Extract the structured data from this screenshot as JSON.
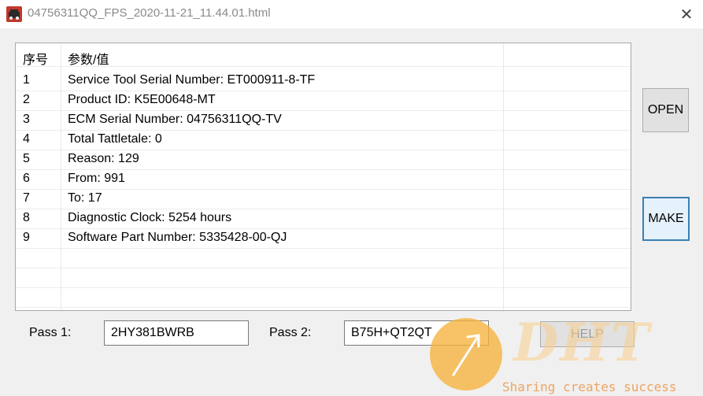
{
  "window": {
    "title": "04756311QQ_FPS_2020-11-21_11.44.01.html",
    "close_glyph": "✕"
  },
  "list": {
    "headers": [
      "序号",
      "参数/值"
    ],
    "rows": [
      {
        "no": "1",
        "value": "Service Tool Serial Number: ET000911-8-TF"
      },
      {
        "no": "2",
        "value": "Product ID: K5E00648-MT"
      },
      {
        "no": "3",
        "value": "ECM Serial Number: 04756311QQ-TV"
      },
      {
        "no": "4",
        "value": "Total Tattletale: 0"
      },
      {
        "no": "5",
        "value": "Reason: 129"
      },
      {
        "no": "6",
        "value": "From: 991"
      },
      {
        "no": "7",
        "value": "To: 17"
      },
      {
        "no": "8",
        "value": "Diagnostic Clock: 5254 hours"
      },
      {
        "no": "9",
        "value": "Software Part Number: 5335428-00-QJ"
      }
    ]
  },
  "buttons": {
    "open": "OPEN",
    "make": "MAKE",
    "help": "HELP"
  },
  "pass": {
    "pass1_label": "Pass 1:",
    "pass1_value": "2HY381BWRB",
    "pass2_label": "Pass 2:",
    "pass2_value": "B75H+QT2QT"
  },
  "watermark": {
    "logo": "DHT",
    "slogan": "Sharing creates success"
  },
  "colors": {
    "accent_border": "#3c7fb1",
    "watermark_orange": "#f6b23c"
  },
  "icons": {
    "app": "app-icon",
    "close": "close-icon",
    "watermark_arrow": "arrow-icon"
  }
}
